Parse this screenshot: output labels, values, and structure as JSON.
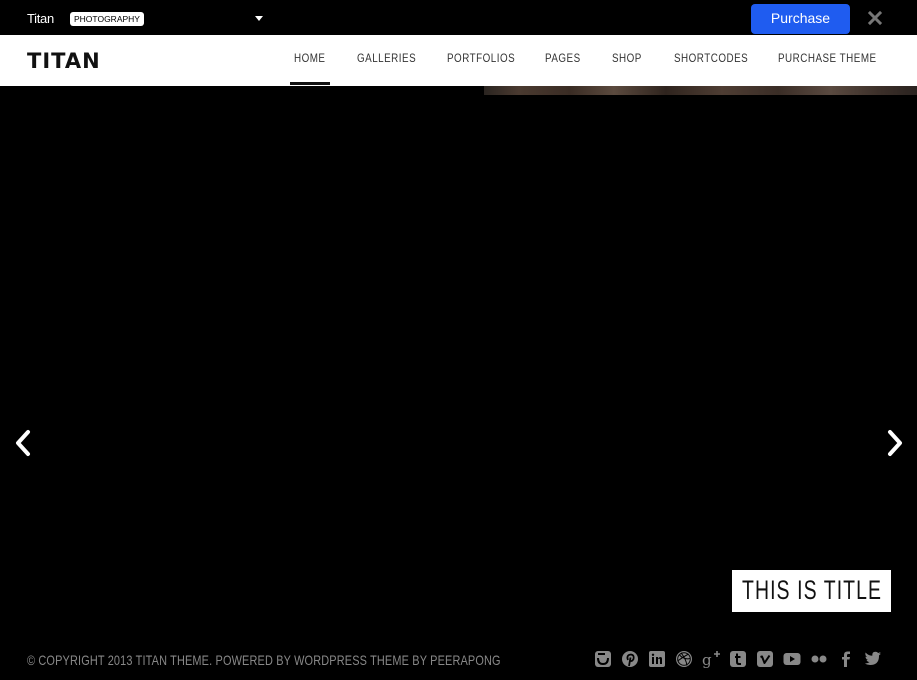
{
  "demo_bar": {
    "title": "Titan",
    "badge": "PHOTOGRAPHY",
    "dropdown_icon": "caret-down-icon",
    "purchase_label": "Purchase",
    "close_icon": "close-icon",
    "colors": {
      "purchase_bg": "#1f5cf0"
    }
  },
  "header": {
    "logo": "TITAN",
    "nav": [
      {
        "label": "HOME",
        "active": true
      },
      {
        "label": "GALLERIES",
        "active": false
      },
      {
        "label": "PORTFOLIOS",
        "active": false
      },
      {
        "label": "PAGES",
        "active": false
      },
      {
        "label": "SHOP",
        "active": false
      },
      {
        "label": "SHORTCODES",
        "active": false
      },
      {
        "label": "PURCHASE THEME",
        "active": false
      }
    ]
  },
  "slider": {
    "prev_icon": "chevron-left-icon",
    "next_icon": "chevron-right-icon",
    "caption": "THIS IS TITLE"
  },
  "footer": {
    "copyright": "© COPYRIGHT 2013 TITAN THEME. POWERED BY WORDPRESS THEME BY PEERAPONG",
    "social": [
      {
        "name": "instagram"
      },
      {
        "name": "pinterest"
      },
      {
        "name": "linkedin"
      },
      {
        "name": "dribbble"
      },
      {
        "name": "google-plus"
      },
      {
        "name": "tumblr"
      },
      {
        "name": "vimeo"
      },
      {
        "name": "youtube"
      },
      {
        "name": "flickr"
      },
      {
        "name": "facebook"
      },
      {
        "name": "twitter"
      }
    ],
    "icon_color": "#888888"
  }
}
